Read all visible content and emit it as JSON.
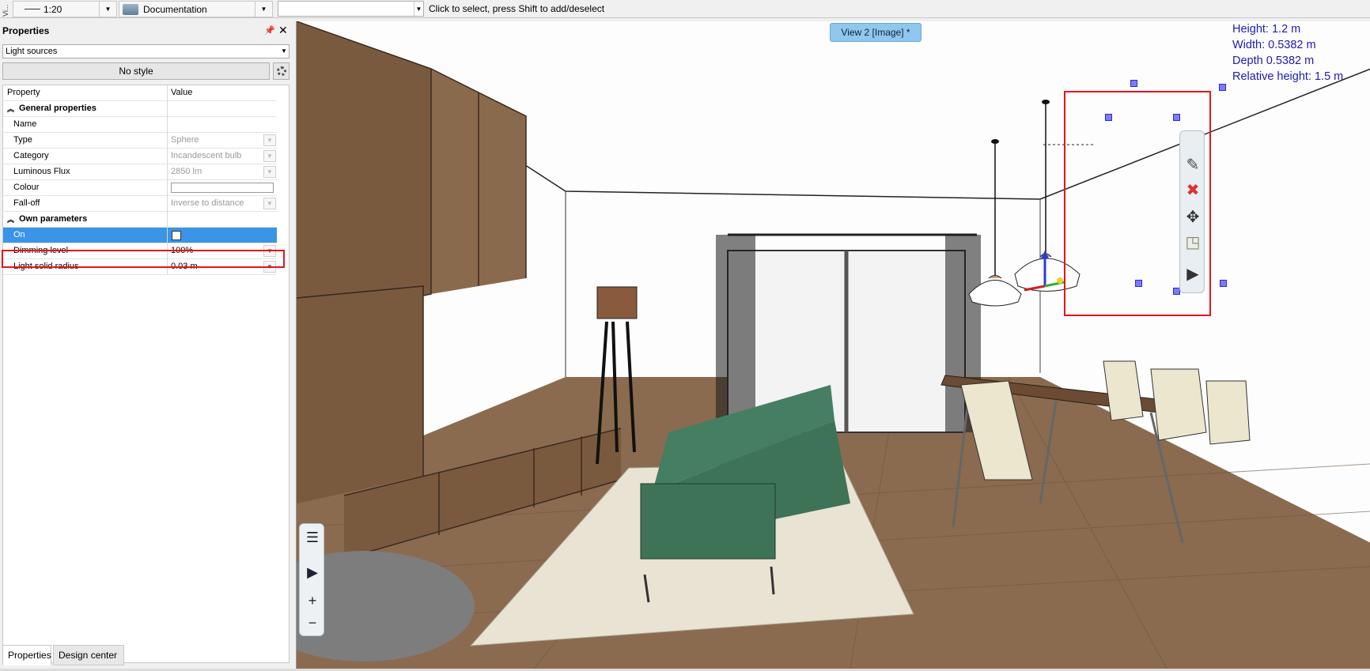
{
  "toolbar": {
    "view_tab_label": "Vi...",
    "scale": "1:20",
    "documentation": "Documentation",
    "command_input": "",
    "hint": "Click to select, press Shift to add/deselect"
  },
  "panel": {
    "title": "Properties",
    "source_select": "Light sources",
    "style_button": "No style",
    "columns": {
      "property": "Property",
      "value": "Value"
    },
    "sections": {
      "general": "General properties",
      "own": "Own parameters"
    },
    "rows": {
      "name": {
        "label": "Name",
        "value": ""
      },
      "type": {
        "label": "Type",
        "value": "Sphere"
      },
      "category": {
        "label": "Category",
        "value": "Incandescent bulb"
      },
      "flux": {
        "label": "Luminous Flux",
        "value": "2850 lm"
      },
      "colour": {
        "label": "Colour",
        "value": ""
      },
      "falloff": {
        "label": "Fall-off",
        "value": "Inverse to distance"
      },
      "on": {
        "label": "On",
        "checked": false
      },
      "dimming": {
        "label": "Dimming level",
        "value": "100%"
      },
      "radius": {
        "label": "Light solid radius",
        "value": "0.03 m"
      }
    },
    "tabs": {
      "properties": "Properties",
      "design_center": "Design center"
    }
  },
  "viewport": {
    "tab_label": "View 2 [Image] *",
    "dimensions": {
      "height": "Height: 1.2 m",
      "width": "Width: 0.5382 m",
      "depth": "Depth 0.5382 m",
      "relative_height": "Relative height: 1.5 m"
    },
    "colors": {
      "selection": "#e8141b",
      "dimension_text": "#1c1cb4",
      "sofa": "#3f7358",
      "wood": "#7a5a3f",
      "floor": "#8a6b4f"
    }
  }
}
